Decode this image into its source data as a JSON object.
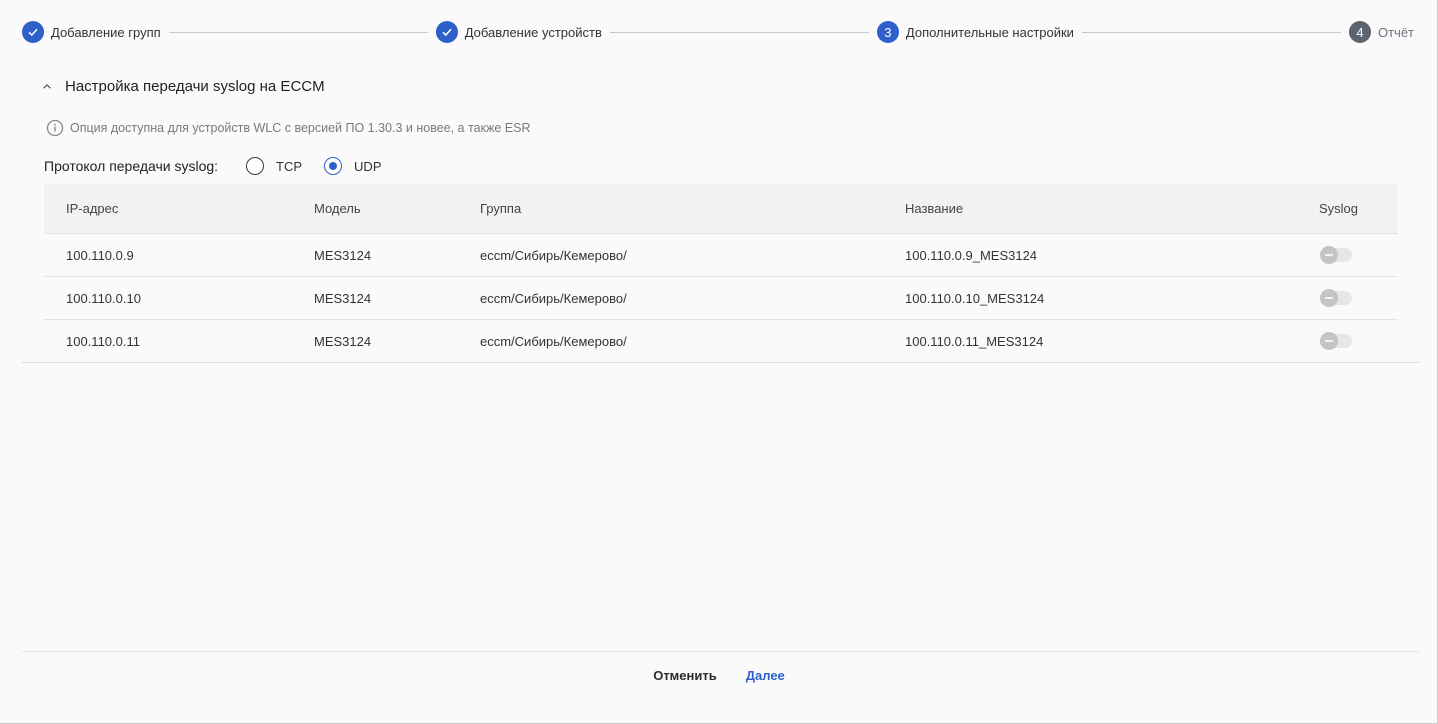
{
  "stepper": {
    "steps": [
      {
        "number": "",
        "label": "Добавление групп",
        "state": "done"
      },
      {
        "number": "",
        "label": "Добавление устройств",
        "state": "done"
      },
      {
        "number": "3",
        "label": "Дополнительные настройки",
        "state": "active"
      },
      {
        "number": "4",
        "label": "Отчёт",
        "state": "pending"
      }
    ]
  },
  "section": {
    "title": "Настройка передачи syslog на ECCM",
    "info": "Опция доступна для устройств WLC с версией ПО 1.30.3 и новее, а также ESR",
    "protocol_label": "Протокол передачи syslog:",
    "protocol_options": [
      "TCP",
      "UDP"
    ],
    "protocol_selected": "UDP"
  },
  "table": {
    "headers": {
      "ip": "IP-адрес",
      "model": "Модель",
      "group": "Группа",
      "name": "Название",
      "syslog": "Syslog"
    },
    "rows": [
      {
        "ip": "100.110.0.9",
        "model": "MES3124",
        "group": "eccm/Сибирь/Кемерово/",
        "name": "100.110.0.9_MES3124",
        "syslog": false
      },
      {
        "ip": "100.110.0.10",
        "model": "MES3124",
        "group": "eccm/Сибирь/Кемерово/",
        "name": "100.110.0.10_MES3124",
        "syslog": false
      },
      {
        "ip": "100.110.0.11",
        "model": "MES3124",
        "group": "eccm/Сибирь/Кемерово/",
        "name": "100.110.0.11_MES3124",
        "syslog": false
      }
    ]
  },
  "footer": {
    "cancel_label": "Отменить",
    "next_label": "Далее"
  },
  "colors": {
    "accent": "#2f5fc9",
    "pending_step": "#5c6470"
  }
}
